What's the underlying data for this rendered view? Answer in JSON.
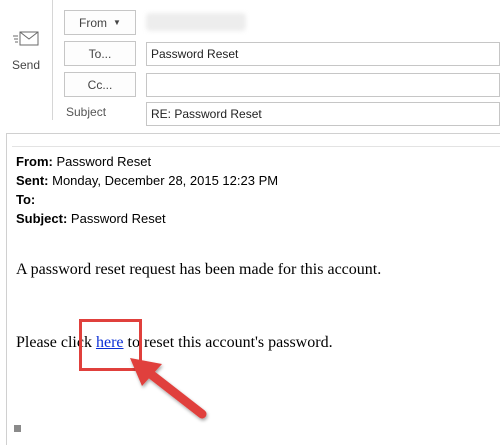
{
  "compose": {
    "send_label": "Send",
    "from_label": "From",
    "to_button_label": "To...",
    "cc_button_label": "Cc...",
    "subject_label": "Subject",
    "to_value": "Password Reset",
    "cc_value": "",
    "subject_value": "RE: Password Reset"
  },
  "quoted_header": {
    "from_label": "From:",
    "from_value": "Password Reset",
    "sent_label": "Sent:",
    "sent_value": "Monday, December 28, 2015 12:23 PM",
    "to_label": "To:",
    "to_value": "",
    "subject_label": "Subject:",
    "subject_value": "Password Reset"
  },
  "message": {
    "line1": "A password reset request has been made for this account.",
    "line2_before": "Please click ",
    "link_text": "here",
    "line2_after": " to reset this account's password."
  },
  "colors": {
    "highlight_box": "#e0403c",
    "arrow": "#e0403c",
    "link": "#0b2fd6"
  }
}
